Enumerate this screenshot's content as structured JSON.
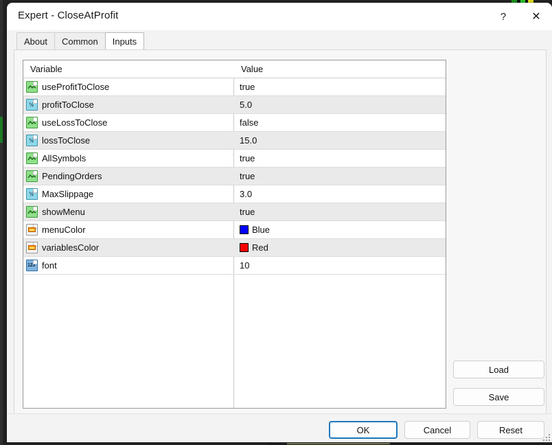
{
  "window": {
    "title": "Expert - CloseAtProfit",
    "help_label": "?",
    "close_label": "✕"
  },
  "tabs": [
    {
      "label": "About",
      "active": false
    },
    {
      "label": "Common",
      "active": false
    },
    {
      "label": "Inputs",
      "active": true
    }
  ],
  "grid": {
    "headers": {
      "variable": "Variable",
      "value": "Value"
    },
    "rows": [
      {
        "icon": "bool-type-icon",
        "variable": "useProfitToClose",
        "value": "true",
        "swatch": null
      },
      {
        "icon": "double-type-icon",
        "variable": "profitToClose",
        "value": "5.0",
        "swatch": null
      },
      {
        "icon": "bool-type-icon",
        "variable": "useLossToClose",
        "value": "false",
        "swatch": null
      },
      {
        "icon": "double-type-icon",
        "variable": "lossToClose",
        "value": "15.0",
        "swatch": null
      },
      {
        "icon": "bool-type-icon",
        "variable": "AllSymbols",
        "value": "true",
        "swatch": null
      },
      {
        "icon": "bool-type-icon",
        "variable": "PendingOrders",
        "value": "true",
        "swatch": null
      },
      {
        "icon": "double-type-icon",
        "variable": "MaxSlippage",
        "value": "3.0",
        "swatch": null
      },
      {
        "icon": "bool-type-icon",
        "variable": "showMenu",
        "value": "true",
        "swatch": null
      },
      {
        "icon": "color-type-icon",
        "variable": "menuColor",
        "value": "Blue",
        "swatch": "#0000ff"
      },
      {
        "icon": "color-type-icon",
        "variable": "variablesColor",
        "value": "Red",
        "swatch": "#ff0000"
      },
      {
        "icon": "int-type-icon",
        "variable": "font",
        "value": "10",
        "swatch": null
      }
    ]
  },
  "side_buttons": {
    "load": "Load",
    "save": "Save"
  },
  "footer_buttons": {
    "ok": "OK",
    "cancel": "Cancel",
    "reset": "Reset"
  },
  "colors": {
    "accent": "#1c77bd",
    "row_alt": "#eaeaea",
    "bool_icon": "#8fe08a",
    "double_icon": "#8fd8ea",
    "int_icon": "#7fb4e0",
    "color_icon_bar": "#ff9b00"
  }
}
